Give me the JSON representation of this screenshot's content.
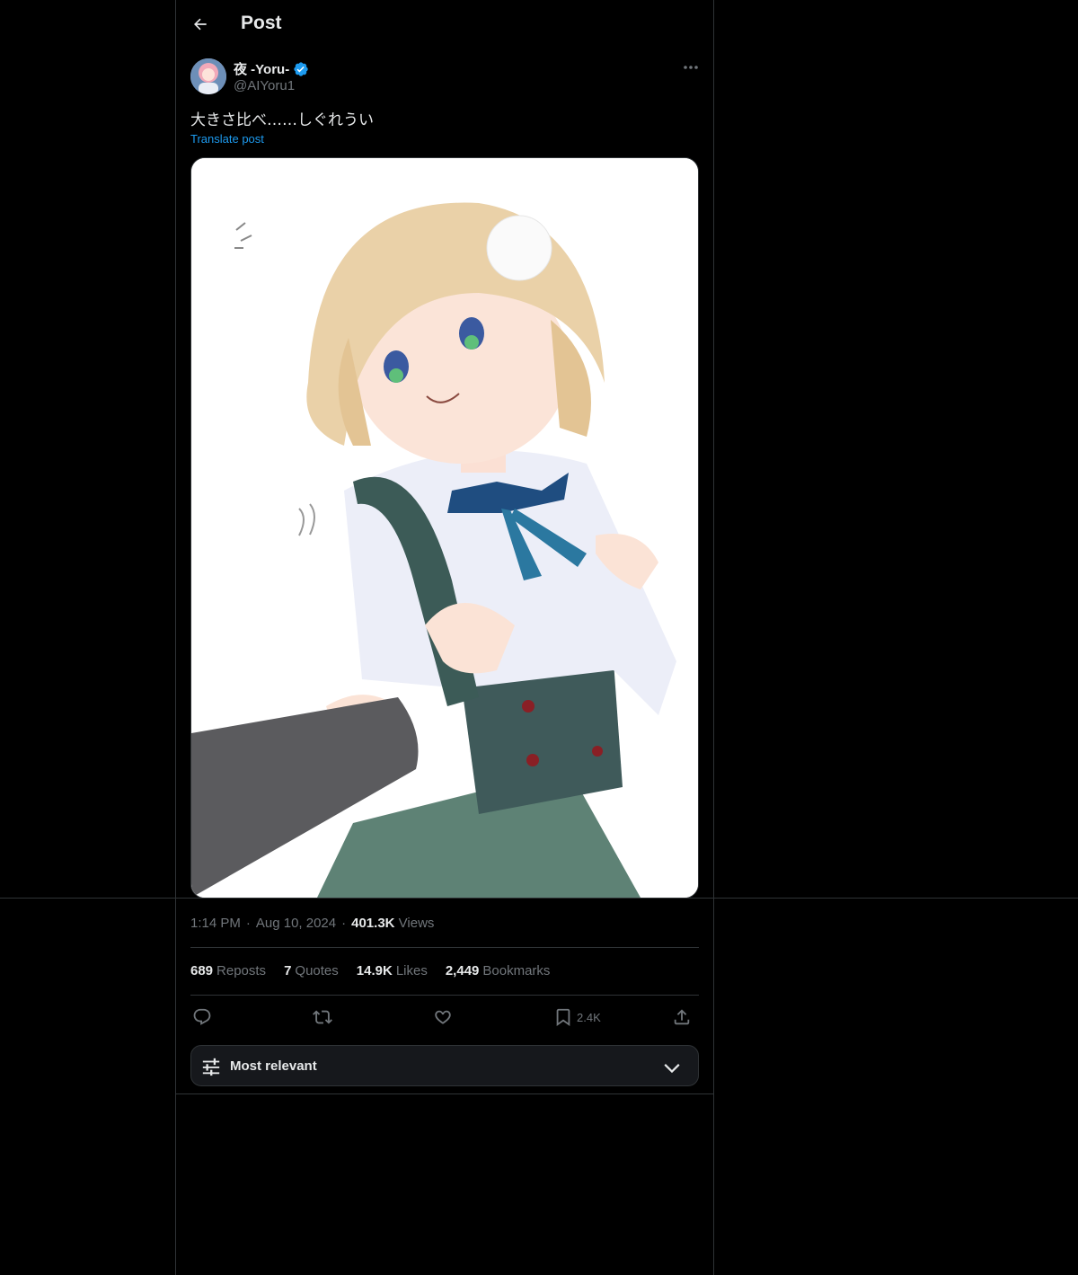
{
  "header": {
    "title": "Post"
  },
  "author": {
    "name": "夜 -Yoru-",
    "handle": "@AIYoru1"
  },
  "post": {
    "text": "大きさ比べ……しぐれうい",
    "translate_label": "Translate post"
  },
  "meta": {
    "time": "1:14 PM",
    "date": "Aug 10, 2024",
    "views_count": "401.3K",
    "views_label": "Views",
    "separator": "·"
  },
  "stats": {
    "reposts_count": "689",
    "reposts_label": "Reposts",
    "quotes_count": "7",
    "quotes_label": "Quotes",
    "likes_count": "14.9K",
    "likes_label": "Likes",
    "bookmarks_count": "2,449",
    "bookmarks_label": "Bookmarks"
  },
  "actions": {
    "bookmark_count": "2.4K"
  },
  "sort": {
    "label": "Most relevant"
  },
  "icons": {
    "back": "arrow-left-icon",
    "verified": "verified-badge-icon",
    "more": "more-dots-icon",
    "reply": "reply-icon",
    "repost": "repost-icon",
    "like": "heart-icon",
    "bookmark": "bookmark-icon",
    "share": "share-icon",
    "sort": "sliders-icon",
    "chevron": "chevron-down-icon"
  },
  "colors": {
    "accent": "#1d9bf0",
    "background": "#000000",
    "text": "#e7e9ea",
    "muted": "#71767b",
    "border": "#2f3336"
  }
}
